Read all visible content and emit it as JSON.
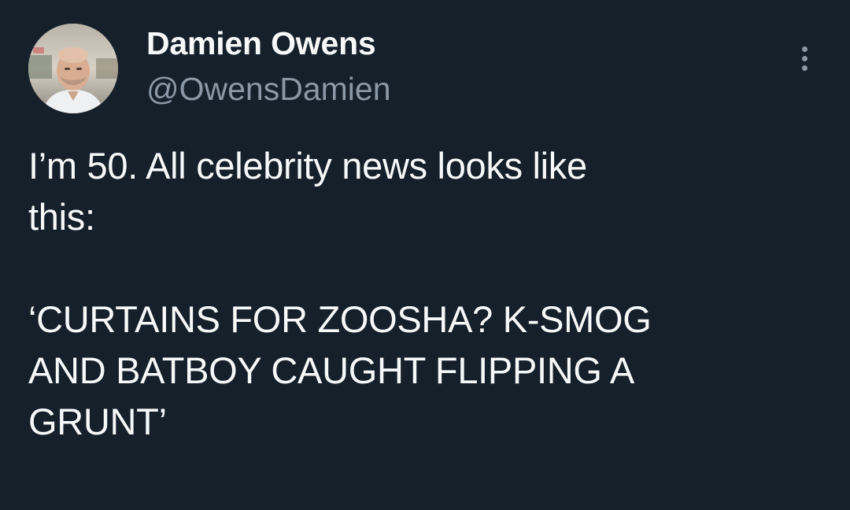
{
  "tweet": {
    "author": {
      "display_name": "Damien Owens",
      "handle": "@OwensDamien"
    },
    "text": "I’m 50. All celebrity news looks like\nthis:\n\n‘CURTAINS FOR ZOOSHA? K-SMOG\nAND BATBOY CAUGHT FLIPPING A\nGRUNT’"
  },
  "icons": {
    "more": "more-options-icon",
    "avatar": "avatar"
  },
  "colors": {
    "background": "#15202b",
    "primary_text": "#f7f9f9",
    "secondary_text": "#8b98a5"
  }
}
